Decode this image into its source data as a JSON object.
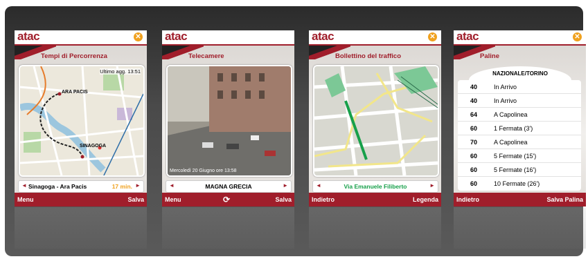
{
  "colors": {
    "brand": "#a01e2b",
    "accent": "#f0a11e"
  },
  "screens": [
    {
      "brand": "atac",
      "title": "Tempi di Percorrenza",
      "updated": "Ultimo agg. 13:51",
      "map_labels": [
        "ARA PACIS",
        "SINAGOGA"
      ],
      "route": "Sinagoga - Ara Pacis",
      "duration": "17 min.",
      "footer_left": "Menu",
      "footer_right": "Salva"
    },
    {
      "brand": "atac",
      "title": "Telecamere",
      "caption": "Mercoledì 20 Giugno ore 13:58",
      "location": "MAGNA GRECIA",
      "footer_left": "Menu",
      "footer_center_icon": "refresh-icon",
      "footer_right": "Salva"
    },
    {
      "brand": "atac",
      "title": "Bollettino del traffico",
      "street": "Via Emanuele Filiberto",
      "footer_left": "Indietro",
      "footer_right": "Legenda"
    },
    {
      "brand": "atac",
      "title": "Paline",
      "stop": "NAZIONALE/TORINO",
      "rows": [
        {
          "line": "40",
          "info": "In Arrivo"
        },
        {
          "line": "40",
          "info": "In Arrivo"
        },
        {
          "line": "64",
          "info": "A Capolinea"
        },
        {
          "line": "60",
          "info": "1 Fermata (3')"
        },
        {
          "line": "70",
          "info": "A Capolinea"
        },
        {
          "line": "60",
          "info": "5 Fermate (15')"
        },
        {
          "line": "60",
          "info": "5 Fermate (16')"
        },
        {
          "line": "60",
          "info": "10 Fermate (26')"
        }
      ],
      "footer_left": "Indietro",
      "footer_right": "Salva Palina"
    }
  ]
}
